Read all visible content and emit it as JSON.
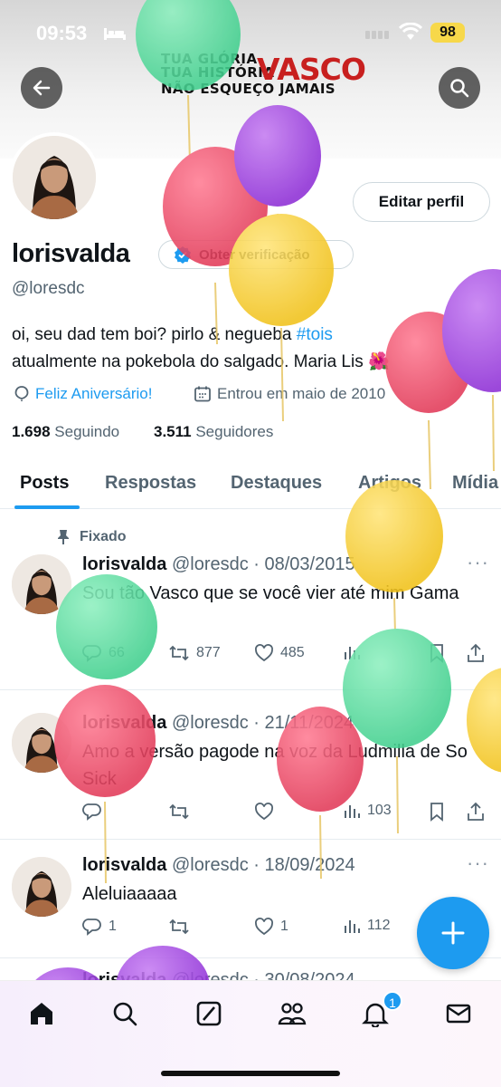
{
  "status_bar": {
    "time": "09:53",
    "battery": "98"
  },
  "banner": {
    "line1": "TUA GLÓRIA",
    "line2": "TUA HISTÓRIA",
    "brand": "VASCO",
    "line3": "NÃO ESQUEÇO JAMAIS"
  },
  "profile": {
    "name": "lorisvalda",
    "handle": "@loresdc",
    "edit_label": "Editar perfil",
    "verify_label": "Obter verificação",
    "bio_line1_a": "oi, seu dad tem boi? pirlo & negueba ",
    "bio_hashtag": "#tois",
    "bio_line2": "atualmente na pokebola do salgado. Maria Lis 🌺",
    "birthday": "Feliz Aniversário!",
    "joined": "Entrou em maio de 2010",
    "following_count": "1.698",
    "following_label": "Seguindo",
    "followers_count": "3.511",
    "followers_label": "Seguidores"
  },
  "tabs": [
    "Posts",
    "Respostas",
    "Destaques",
    "Artigos",
    "Mídia"
  ],
  "tweets": [
    {
      "pinned_label": "Fixado",
      "name": "lorisvalda",
      "meta": "@loresdc · 08/03/2015",
      "text": "Sou tão Vasco que se você vier até mim Gama",
      "replies": "66",
      "retweets": "877",
      "likes": "485",
      "views": ""
    },
    {
      "name": "lorisvalda",
      "meta": "@loresdc · 21/11/2024",
      "text": "Amo a versão pagode na voz da Ludmilla de So Sick",
      "replies": "",
      "retweets": "",
      "likes": "",
      "views": "103"
    },
    {
      "name": "lorisvalda",
      "meta": "@loresdc · 18/09/2024",
      "text": "Aleluiaaaaa",
      "replies": "1",
      "retweets": "",
      "likes": "1",
      "views": "112"
    },
    {
      "name": "lorisvalda",
      "meta": "@loresdc · 30/08/2024"
    }
  ],
  "nav": {
    "notifications_badge": "1"
  },
  "colors": {
    "accent": "#1d9bf0",
    "vasco_red": "#c8201f"
  }
}
